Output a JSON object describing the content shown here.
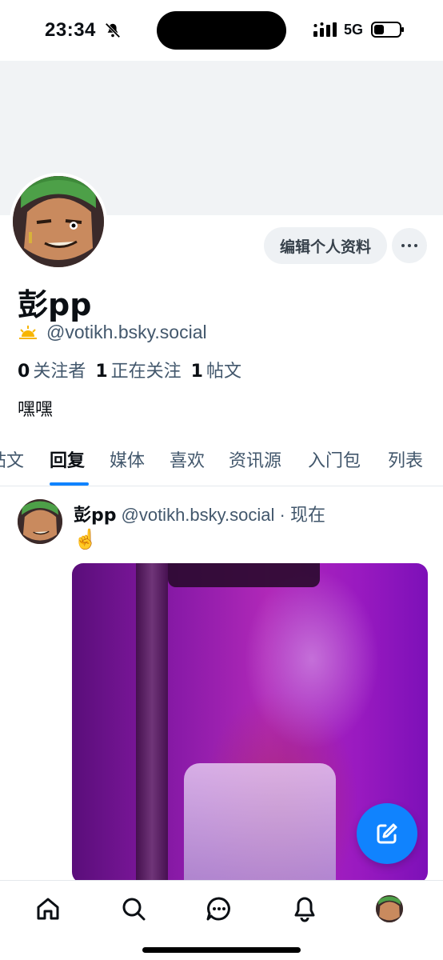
{
  "status_bar": {
    "time": "23:34",
    "network": "5G"
  },
  "profile": {
    "display_name": "彭pp",
    "handle": "@votikh.bsky.social",
    "edit_button": "编辑个人资料",
    "followers_count": "0",
    "followers_label": "关注者",
    "following_count": "1",
    "following_label": "正在关注",
    "posts_count": "1",
    "posts_label": "帖文",
    "bio": "嘿嘿"
  },
  "tabs": [
    "帖文",
    "回复",
    "媒体",
    "喜欢",
    "资讯源",
    "入门包",
    "列表"
  ],
  "active_tab": "回复",
  "post": {
    "author": "彭pp",
    "handle": "@votikh.bsky.social",
    "separator": "·",
    "time": "现在",
    "text": "☝️"
  },
  "colors": {
    "accent": "#1083fe",
    "muted_text": "#42576c",
    "banner": "#f1f3f5"
  },
  "bottom_nav": [
    "home-icon",
    "search-icon",
    "chat-icon",
    "bell-icon",
    "profile-avatar"
  ]
}
